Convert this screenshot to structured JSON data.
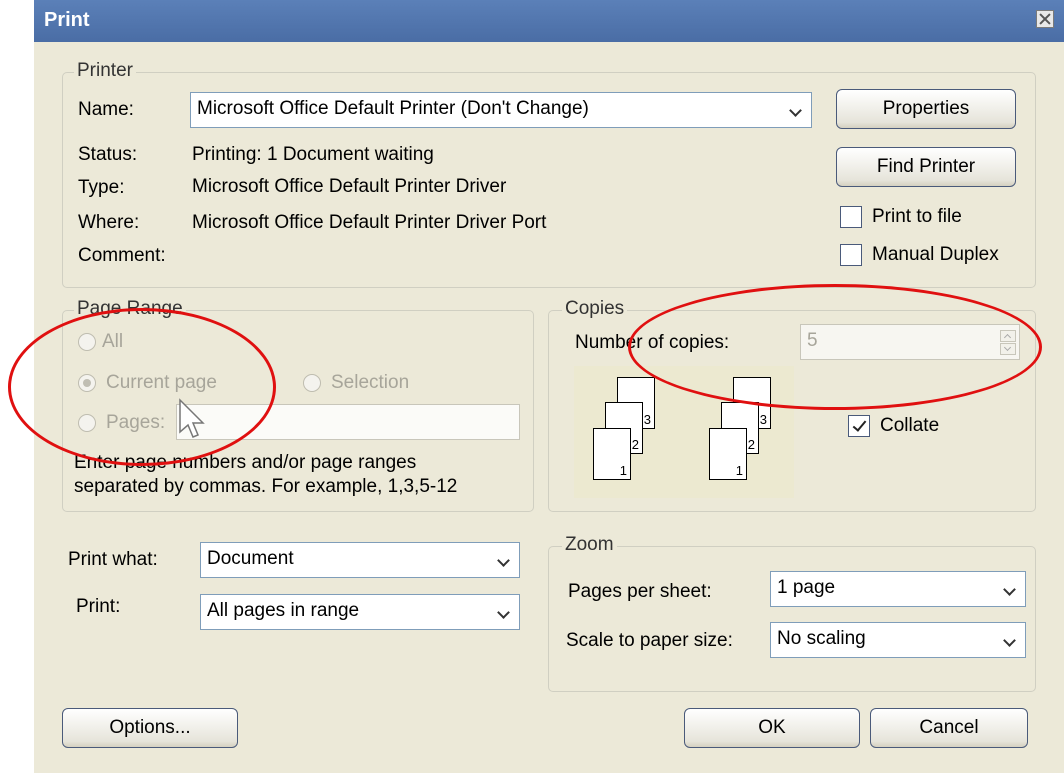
{
  "window": {
    "title": "Print"
  },
  "printer": {
    "legend": "Printer",
    "name_label": "Name:",
    "name_value": "Microsoft Office Default Printer (Don't Change)",
    "status_label": "Status:",
    "status_value": "Printing: 1 Document waiting",
    "type_label": "Type:",
    "type_value": "Microsoft Office Default Printer Driver",
    "where_label": "Where:",
    "where_value": "Microsoft Office Default Printer Driver Port",
    "comment_label": "Comment:",
    "properties_label": "Properties",
    "find_printer_label": "Find Printer",
    "print_to_file_label": "Print to file",
    "print_to_file_checked": false,
    "manual_duplex_label": "Manual Duplex",
    "manual_duplex_checked": false
  },
  "page_range": {
    "legend": "Page Range",
    "all_label": "All",
    "current_page_label": "Current page",
    "selection_label": "Selection",
    "pages_label": "Pages:",
    "pages_value": "",
    "selected": "current_page",
    "hint_line1": "Enter page numbers and/or page ranges",
    "hint_line2": "separated by commas. For example, 1,3,5-12"
  },
  "copies": {
    "legend": "Copies",
    "number_label": "Number of copies:",
    "number_value": "5",
    "collate_label": "Collate",
    "collate_checked": true,
    "page_numbers": [
      "1",
      "2",
      "3"
    ]
  },
  "print_what": {
    "label": "Print what:",
    "value": "Document"
  },
  "print": {
    "label": "Print:",
    "value": "All pages in range"
  },
  "zoom": {
    "legend": "Zoom",
    "pages_per_sheet_label": "Pages per sheet:",
    "pages_per_sheet_value": "1 page",
    "scale_label": "Scale to paper size:",
    "scale_value": "No scaling"
  },
  "buttons": {
    "options": "Options...",
    "ok": "OK",
    "cancel": "Cancel"
  },
  "colors": {
    "annotation": "#e01010",
    "titlebar": "#4a6da5",
    "dialog_bg": "#ece9d8"
  }
}
